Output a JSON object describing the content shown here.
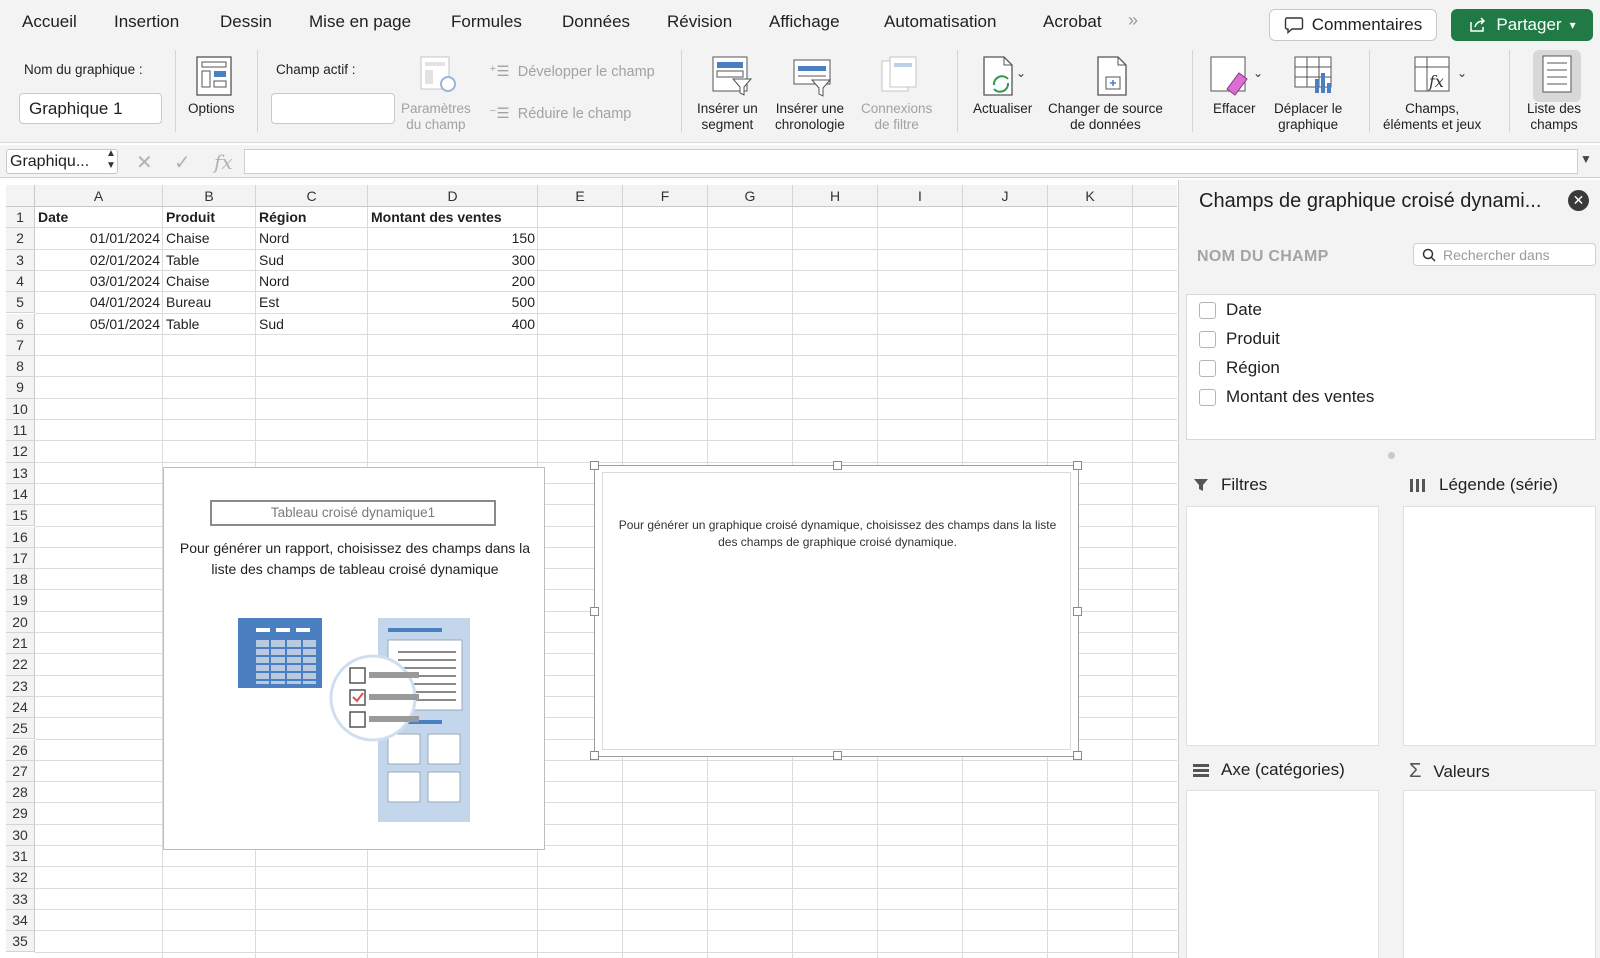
{
  "menu": {
    "items": [
      "Accueil",
      "Insertion",
      "Dessin",
      "Mise en page",
      "Formules",
      "Données",
      "Révision",
      "Affichage",
      "Automatisation",
      "Acrobat"
    ],
    "more": "»",
    "comments": "Commentaires",
    "share": "Partager"
  },
  "ribbon": {
    "chart_name_label": "Nom du graphique :",
    "chart_name_value": "Graphique 1",
    "options": "Options",
    "active_field_label": "Champ actif :",
    "active_field_value": "",
    "field_settings_1": "Paramètres",
    "field_settings_2": "du champ",
    "expand_field": "Développer le champ",
    "collapse_field": "Réduire le champ",
    "insert_slicer_1": "Insérer un",
    "insert_slicer_2": "segment",
    "insert_timeline_1": "Insérer une",
    "insert_timeline_2": "chronologie",
    "filter_conn_1": "Connexions",
    "filter_conn_2": "de filtre",
    "refresh": "Actualiser",
    "change_source_1": "Changer de source",
    "change_source_2": "de données",
    "clear": "Effacer",
    "move_chart_1": "Déplacer le",
    "move_chart_2": "graphique",
    "fields_items_1": "Champs,",
    "fields_items_2": "éléments et jeux",
    "field_list_1": "Liste des",
    "field_list_2": "champs"
  },
  "formula": {
    "name_box": "Graphiqu...",
    "content": ""
  },
  "grid": {
    "columns": [
      "A",
      "B",
      "C",
      "D",
      "E",
      "F",
      "G",
      "H",
      "I",
      "J",
      "K"
    ],
    "rows": [
      "1",
      "2",
      "3",
      "4",
      "5",
      "6",
      "7",
      "8",
      "9",
      "10",
      "11",
      "12",
      "13",
      "14",
      "15",
      "16",
      "17",
      "18",
      "19",
      "20",
      "21",
      "22",
      "23",
      "24",
      "25",
      "26",
      "27",
      "28",
      "29",
      "30",
      "31",
      "32",
      "33",
      "34",
      "35"
    ],
    "headers": [
      "Date",
      "Produit",
      "Région",
      "Montant des ventes"
    ],
    "data": [
      [
        "01/01/2024",
        "Chaise",
        "Nord",
        "150"
      ],
      [
        "02/01/2024",
        "Table",
        "Sud",
        "300"
      ],
      [
        "03/01/2024",
        "Chaise",
        "Nord",
        "200"
      ],
      [
        "04/01/2024",
        "Bureau",
        "Est",
        "500"
      ],
      [
        "05/01/2024",
        "Table",
        "Sud",
        "400"
      ]
    ]
  },
  "pivot": {
    "title": "Tableau croisé dynamique1",
    "message": "Pour générer un rapport, choisissez des champs dans la liste des champs de tableau croisé dynamique"
  },
  "chart": {
    "message": "Pour générer un graphique croisé dynamique, choisissez des champs dans la liste des champs de graphique croisé dynamique."
  },
  "pane": {
    "title": "Champs de graphique croisé dynami...",
    "field_name_header": "NOM DU CHAMP",
    "search_placeholder": "Rechercher dans",
    "fields": [
      "Date",
      "Produit",
      "Région",
      "Montant des ventes"
    ],
    "filters": "Filtres",
    "legend": "Légende (série)",
    "axis": "Axe (catégories)",
    "values": "Valeurs"
  },
  "colors": {
    "share": "#1f7a45",
    "accent_blue": "#4a7fc1",
    "check_red": "#d9534f"
  }
}
